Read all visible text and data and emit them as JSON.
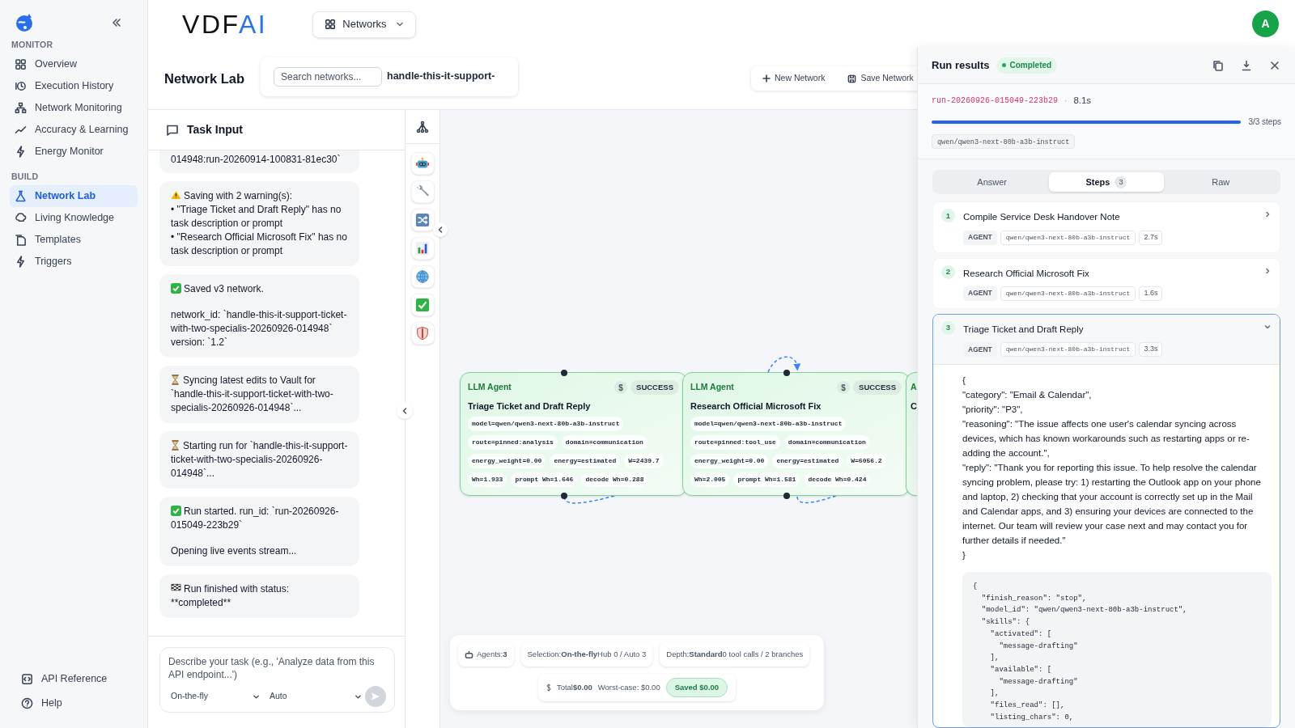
{
  "topbar": {
    "logo": {
      "prefix": "VDF",
      "suffix": "AI"
    },
    "dropdown": "Networks",
    "avatar": "A"
  },
  "sidebar": {
    "sections": [
      {
        "title": "MONITOR",
        "items": [
          {
            "label": "Overview",
            "selected": false
          },
          {
            "label": "Execution History",
            "selected": false
          },
          {
            "label": "Network Monitoring",
            "selected": false
          },
          {
            "label": "Accuracy & Learning",
            "selected": false
          },
          {
            "label": "Energy Monitor",
            "selected": false
          }
        ]
      },
      {
        "title": "BUILD",
        "items": [
          {
            "label": "Network Lab",
            "selected": true
          },
          {
            "label": "Living Knowledge",
            "selected": false
          },
          {
            "label": "Templates",
            "selected": false
          },
          {
            "label": "Triggers",
            "selected": false
          }
        ]
      }
    ],
    "footer": [
      {
        "label": "API Reference"
      },
      {
        "label": "Help"
      }
    ]
  },
  "header": {
    "title": "Network Lab",
    "search_placeholder": "Search networks...",
    "network_name": "handle-this-it-support-",
    "actions": [
      "New Network",
      "Save Network"
    ]
  },
  "task_input": {
    "title": "Task Input",
    "messages": [
      {
        "paragraphs": [
          "014948:run-20260914-100831-81ec30`"
        ]
      },
      {
        "kind": "warning",
        "paragraphs": [
          "Saving with 2 warning(s):\n• \"Triage Ticket and Draft Reply\" has no task description or prompt\n• \"Research Official Microsoft Fix\" has no task description or prompt"
        ]
      },
      {
        "kind": "check",
        "paragraphs": [
          "Saved v3 network.",
          "network_id: `handle-this-it-support-ticket-with-two-specialis-20260926-014948`\nversion: `1.2`"
        ]
      },
      {
        "kind": "hourglass",
        "paragraphs": [
          "Syncing latest edits to Vault for `handle-this-it-support-ticket-with-two-specialis-20260926-014948`..."
        ]
      },
      {
        "kind": "hourglass",
        "paragraphs": [
          "Starting run for `handle-this-it-support-ticket-with-two-specialis-20260926-014948`..."
        ]
      },
      {
        "kind": "check",
        "paragraphs": [
          "Run started. run_id: `run-20260926-015049-223b29`",
          "Opening live events stream..."
        ]
      },
      {
        "kind": "flag",
        "paragraphs": [
          "Run finished with status: **completed**"
        ]
      }
    ],
    "composer": {
      "placeholder": "Describe your task (e.g., 'Analyze data from this API endpoint...')",
      "mode": "On-the-fly",
      "model": "Auto",
      "send_disabled": true
    }
  },
  "canvas": {
    "nodes": [
      {
        "label": "LLM Agent",
        "cost": "$",
        "status": "SUCCESS",
        "title": "Triage Ticket and Draft Reply",
        "chips": [
          "model=qwen/qwen3-next-80b-a3b-instruct",
          "route=pinned:analysis",
          "domain=communication",
          "energy_weight=0.00",
          "energy=estimated",
          "W=2439.7",
          "Wh=1.933",
          "prompt Wh=1.646",
          "decode Wh=0.288"
        ]
      },
      {
        "label": "LLM Agent",
        "cost": "$",
        "status": "SUCCESS",
        "title": "Research Official Microsoft Fix",
        "chips": [
          "model=qwen/qwen3-next-80b-a3b-instruct",
          "route=pinned:tool_use",
          "domain=communication",
          "energy_weight=0.00",
          "energy=estimated",
          "W=6056.2",
          "Wh=2.005",
          "prompt Wh=1.581",
          "decode Wh=0.424"
        ]
      },
      {
        "label": "A",
        "title": "C"
      }
    ],
    "summary": {
      "chips": [
        "Agents:**3**",
        "Selection:**On-the-fly**Hub 0 / Auto 3",
        "Depth:**Standard**0 tool calls / 2 branches"
      ],
      "total": "Total**$0.00**",
      "worst_case": "Worst-case: $0.00",
      "saved": "Saved $0.00"
    }
  },
  "run_results": {
    "title": "Run results",
    "status": {
      "label": "Completed"
    },
    "run_id": "run-20260926-015049-223b29",
    "separator": "·",
    "duration": "8.1s",
    "progress": {
      "level": 1,
      "label": "3/3 steps"
    },
    "model": "qwen/qwen3-next-80b-a3b-instruct",
    "tabs": [
      {
        "label": "Answer",
        "selected": false
      },
      {
        "label": "Steps",
        "count": "3",
        "selected": true
      },
      {
        "label": "Raw",
        "selected": false
      }
    ],
    "steps": [
      {
        "number": "1",
        "title": "Compile Service Desk Handover Note",
        "type": "AGENT",
        "model": "qwen/qwen3-next-80b-a3b-instruct",
        "duration": "2.7s",
        "expanded": false
      },
      {
        "number": "2",
        "title": "Research Official Microsoft Fix",
        "type": "AGENT",
        "model": "qwen/qwen3-next-80b-a3b-instruct",
        "duration": "1.6s",
        "expanded": false
      },
      {
        "number": "3",
        "title": "Triage Ticket and Draft Reply",
        "type": "AGENT",
        "model": "qwen/qwen3-next-80b-a3b-instruct",
        "duration": "3.3s",
        "expanded": true,
        "answer_lines": [
          "{",
          "\"category\": \"Email & Calendar\",",
          "\"priority\": \"P3\",",
          "\"reasoning\": \"The issue affects one user's calendar syncing across devices, which has known workarounds such as restarting apps or re-adding the account.\",",
          "\"reply\": \"Thank you for reporting this issue. To help resolve the calendar syncing problem, please try: 1) restarting the Outlook app on your phone and laptop, 2) checking that your account is correctly set up in the Mail and Calendar apps, and 3) ensuring your devices are connected to the internet. Our team will review your case next and may contact you for further details if needed.\"",
          "}"
        ],
        "raw": "{\n  \"finish_reason\": \"stop\",\n  \"model_id\": \"qwen/qwen3-next-80b-a3b-instruct\",\n  \"skills\": {\n    \"activated\": [\n      \"message-drafting\"\n    ],\n    \"available\": [\n      \"message-drafting\"\n    ],\n    \"files_read\": [],\n    \"listing_chars\": 0,"
      }
    ]
  }
}
